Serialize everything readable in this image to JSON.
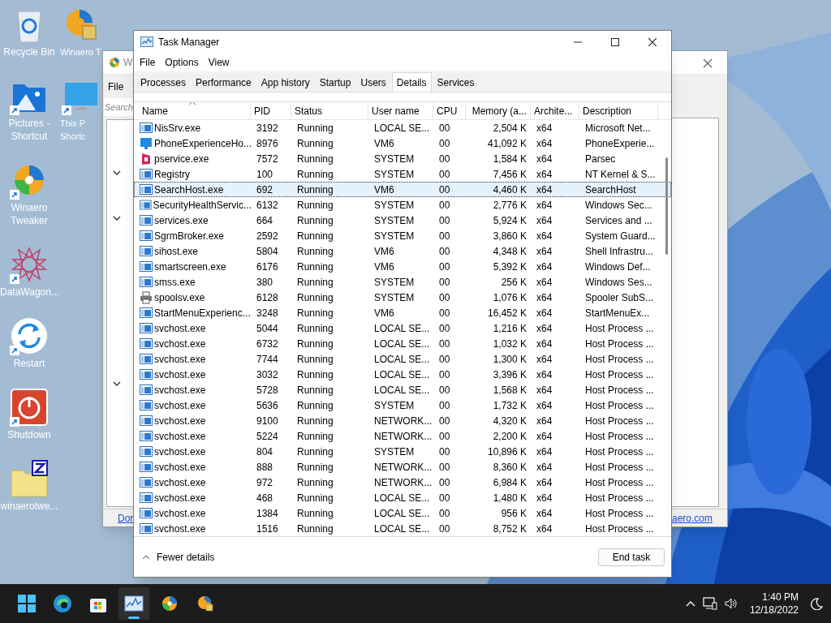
{
  "desktop_icons": {
    "columns": [
      [
        {
          "label": "Recycle Bin",
          "kind": "recycle",
          "shortcut": false
        },
        {
          "label": "Pictures - Shortcut",
          "kind": "pictures",
          "shortcut": true
        },
        {
          "label": "Winaero Tweaker",
          "kind": "winaero",
          "shortcut": true
        },
        {
          "label": "DataWagon...",
          "kind": "star",
          "shortcut": true
        },
        {
          "label": "Restart",
          "kind": "restart",
          "shortcut": true
        },
        {
          "label": "Shutdown",
          "kind": "shutdown",
          "shortcut": true
        },
        {
          "label": "winaerotwe...",
          "kind": "zip",
          "shortcut": false
        }
      ],
      [
        {
          "label": "Winaero T",
          "kind": "winaero_setup",
          "shortcut": false
        },
        {
          "label": "This P\nShortc",
          "kind": "monitor",
          "shortcut": true
        }
      ]
    ]
  },
  "background_window": {
    "title": "W",
    "menu": "File",
    "search_placeholder": "Search",
    "link_left": "Dor",
    "link_right": "aero.com"
  },
  "task_manager": {
    "title": "Task Manager",
    "menu": [
      "File",
      "Options",
      "View"
    ],
    "tabs": [
      {
        "label": "Processes",
        "selected": false
      },
      {
        "label": "Performance",
        "selected": false
      },
      {
        "label": "App history",
        "selected": false
      },
      {
        "label": "Startup",
        "selected": false
      },
      {
        "label": "Users",
        "selected": false
      },
      {
        "label": "Details",
        "selected": true
      },
      {
        "label": "Services",
        "selected": false
      }
    ],
    "table": {
      "columns": [
        "Name",
        "PID",
        "Status",
        "User name",
        "CPU",
        "Memory (a...",
        "Archite...",
        "Description"
      ],
      "rows": [
        {
          "kind": "app",
          "cells": [
            "NisSrv.exe",
            "3192",
            "Running",
            "LOCAL SE...",
            "00",
            "2,504 K",
            "x64",
            "Microsoft Net..."
          ],
          "selected": false
        },
        {
          "kind": "monitor",
          "cells": [
            "PhoneExperienceHo...",
            "8976",
            "Running",
            "VM6",
            "00",
            "41,092 K",
            "x64",
            "PhoneExperie..."
          ],
          "selected": false
        },
        {
          "kind": "parsec",
          "cells": [
            "pservice.exe",
            "7572",
            "Running",
            "SYSTEM",
            "00",
            "1,584 K",
            "x64",
            "Parsec"
          ],
          "selected": false
        },
        {
          "kind": "app",
          "cells": [
            "Registry",
            "100",
            "Running",
            "SYSTEM",
            "00",
            "7,456 K",
            "x64",
            "NT Kernel & S..."
          ],
          "selected": false
        },
        {
          "kind": "app",
          "cells": [
            "SearchHost.exe",
            "692",
            "Running",
            "VM6",
            "00",
            "4,460 K",
            "x64",
            "SearchHost"
          ],
          "selected": true
        },
        {
          "kind": "app",
          "cells": [
            "SecurityHealthServic...",
            "6132",
            "Running",
            "SYSTEM",
            "00",
            "2,776 K",
            "x64",
            "Windows Sec..."
          ],
          "selected": false
        },
        {
          "kind": "app",
          "cells": [
            "services.exe",
            "664",
            "Running",
            "SYSTEM",
            "00",
            "5,924 K",
            "x64",
            "Services and ..."
          ],
          "selected": false
        },
        {
          "kind": "app",
          "cells": [
            "SgrmBroker.exe",
            "2592",
            "Running",
            "SYSTEM",
            "00",
            "3,860 K",
            "x64",
            "System Guard..."
          ],
          "selected": false
        },
        {
          "kind": "app",
          "cells": [
            "sihost.exe",
            "5804",
            "Running",
            "VM6",
            "00",
            "4,348 K",
            "x64",
            "Shell Infrastru..."
          ],
          "selected": false
        },
        {
          "kind": "app",
          "cells": [
            "smartscreen.exe",
            "6176",
            "Running",
            "VM6",
            "00",
            "5,392 K",
            "x64",
            "Windows Def..."
          ],
          "selected": false
        },
        {
          "kind": "app",
          "cells": [
            "smss.exe",
            "380",
            "Running",
            "SYSTEM",
            "00",
            "256 K",
            "x64",
            "Windows Ses..."
          ],
          "selected": false
        },
        {
          "kind": "printer",
          "cells": [
            "spoolsv.exe",
            "6128",
            "Running",
            "SYSTEM",
            "00",
            "1,076 K",
            "x64",
            "Spooler SubS..."
          ],
          "selected": false
        },
        {
          "kind": "app",
          "cells": [
            "StartMenuExperienc...",
            "3248",
            "Running",
            "VM6",
            "00",
            "16,452 K",
            "x64",
            "StartMenuEx..."
          ],
          "selected": false
        },
        {
          "kind": "app",
          "cells": [
            "svchost.exe",
            "5044",
            "Running",
            "LOCAL SE...",
            "00",
            "1,216 K",
            "x64",
            "Host Process ..."
          ],
          "selected": false
        },
        {
          "kind": "app",
          "cells": [
            "svchost.exe",
            "6732",
            "Running",
            "LOCAL SE...",
            "00",
            "1,032 K",
            "x64",
            "Host Process ..."
          ],
          "selected": false
        },
        {
          "kind": "app",
          "cells": [
            "svchost.exe",
            "7744",
            "Running",
            "LOCAL SE...",
            "00",
            "1,300 K",
            "x64",
            "Host Process ..."
          ],
          "selected": false
        },
        {
          "kind": "app",
          "cells": [
            "svchost.exe",
            "3032",
            "Running",
            "LOCAL SE...",
            "00",
            "3,396 K",
            "x64",
            "Host Process ..."
          ],
          "selected": false
        },
        {
          "kind": "app",
          "cells": [
            "svchost.exe",
            "5728",
            "Running",
            "LOCAL SE...",
            "00",
            "1,568 K",
            "x64",
            "Host Process ..."
          ],
          "selected": false
        },
        {
          "kind": "app",
          "cells": [
            "svchost.exe",
            "5636",
            "Running",
            "SYSTEM",
            "00",
            "1,732 K",
            "x64",
            "Host Process ..."
          ],
          "selected": false
        },
        {
          "kind": "app",
          "cells": [
            "svchost.exe",
            "9100",
            "Running",
            "NETWORK...",
            "00",
            "4,320 K",
            "x64",
            "Host Process ..."
          ],
          "selected": false
        },
        {
          "kind": "app",
          "cells": [
            "svchost.exe",
            "5224",
            "Running",
            "NETWORK...",
            "00",
            "2,200 K",
            "x64",
            "Host Process ..."
          ],
          "selected": false
        },
        {
          "kind": "app",
          "cells": [
            "svchost.exe",
            "804",
            "Running",
            "SYSTEM",
            "00",
            "10,896 K",
            "x64",
            "Host Process ..."
          ],
          "selected": false
        },
        {
          "kind": "app",
          "cells": [
            "svchost.exe",
            "888",
            "Running",
            "NETWORK...",
            "00",
            "8,360 K",
            "x64",
            "Host Process ..."
          ],
          "selected": false
        },
        {
          "kind": "app",
          "cells": [
            "svchost.exe",
            "972",
            "Running",
            "NETWORK...",
            "00",
            "6,984 K",
            "x64",
            "Host Process ..."
          ],
          "selected": false
        },
        {
          "kind": "app",
          "cells": [
            "svchost.exe",
            "468",
            "Running",
            "LOCAL SE...",
            "00",
            "1,480 K",
            "x64",
            "Host Process ..."
          ],
          "selected": false
        },
        {
          "kind": "app",
          "cells": [
            "svchost.exe",
            "1384",
            "Running",
            "LOCAL SE...",
            "00",
            "956 K",
            "x64",
            "Host Process ..."
          ],
          "selected": false
        },
        {
          "kind": "app",
          "cells": [
            "svchost.exe",
            "1516",
            "Running",
            "LOCAL SE...",
            "00",
            "8,752 K",
            "x64",
            "Host Process ..."
          ],
          "selected": false
        }
      ]
    },
    "footer": {
      "toggle": "Fewer details",
      "button": "End task"
    }
  },
  "taskbar": {
    "apps": [
      {
        "kind": "start",
        "selected": false
      },
      {
        "kind": "edge",
        "selected": false
      },
      {
        "kind": "store",
        "selected": false
      },
      {
        "kind": "taskmgr",
        "selected": true
      },
      {
        "kind": "winaero",
        "selected": false
      },
      {
        "kind": "winaero_setup",
        "selected": false
      }
    ],
    "time": "1:40 PM",
    "date": "12/18/2022"
  }
}
